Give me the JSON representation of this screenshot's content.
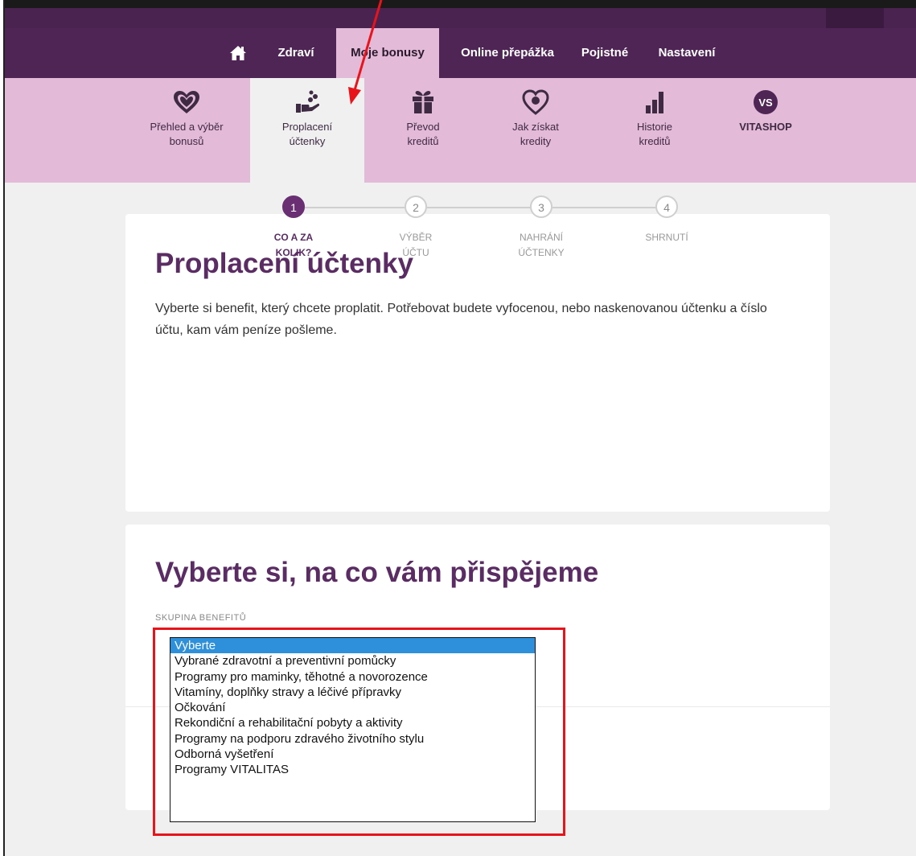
{
  "main_nav": {
    "items": [
      {
        "label": "",
        "icon": "home-icon"
      },
      {
        "label": "Zdraví"
      },
      {
        "label": "Moje bonusy",
        "active": true
      },
      {
        "label": "Online přepážka"
      },
      {
        "label": "Pojistné"
      },
      {
        "label": "Nastavení"
      }
    ]
  },
  "sub_nav": {
    "items": [
      {
        "line1": "Přehled a výběr",
        "line2": "bonusů",
        "icon": "heart-icon"
      },
      {
        "line1": "Proplacení",
        "line2": "účtenky",
        "icon": "hand-coins-icon",
        "active": true
      },
      {
        "line1": "Převod",
        "line2": "kreditů",
        "icon": "gift-icon"
      },
      {
        "line1": "Jak získat",
        "line2": "kredity",
        "icon": "heart-badge-icon"
      },
      {
        "line1": "Historie",
        "line2": "kreditů",
        "icon": "bar-chart-icon"
      },
      {
        "line1": "VITASHOP",
        "line2": "",
        "icon": "vs-badge-icon",
        "badge": "VS"
      }
    ]
  },
  "card1": {
    "title": "Proplacení účtenky",
    "description": "Vyberte si benefit, který chcete proplatit. Potřebovat budete vyfocenou, nebo naskenovanou účtenku a číslo účtu, kam vám peníze pošleme."
  },
  "steps": [
    {
      "number": "1",
      "line1": "CO A ZA",
      "line2": "KOLIK?",
      "active": true
    },
    {
      "number": "2",
      "line1": "VÝBĚR",
      "line2": "ÚČTU"
    },
    {
      "number": "3",
      "line1": "NAHRÁNÍ",
      "line2": "ÚČTENKY"
    },
    {
      "number": "4",
      "line1": "SHRNUTÍ",
      "line2": ""
    }
  ],
  "card2": {
    "title": "Vyberte si, na co vám přispějeme",
    "group_label": "SKUPINA BENEFITŮ"
  },
  "benefit_list": {
    "options": [
      "Vyberte",
      "Vybrané zdravotní a preventivní pomůcky",
      "Programy pro maminky, těhotné a novorozence",
      "Vitamíny, doplňky stravy a léčivé přípravky",
      "Očkování",
      "Rekondiční a rehabilitační pobyty a aktivity",
      "Programy na podporu zdravého životního stylu",
      "Odborná vyšetření",
      "Programy VITALITAS"
    ],
    "selected_index": 0,
    "selected_color": "#2e8fdb"
  },
  "colors": {
    "brand_dark": "#4f2556",
    "brand_light": "#e3bad8",
    "heading": "#5a2c63",
    "annotation_red": "#e8141b"
  }
}
